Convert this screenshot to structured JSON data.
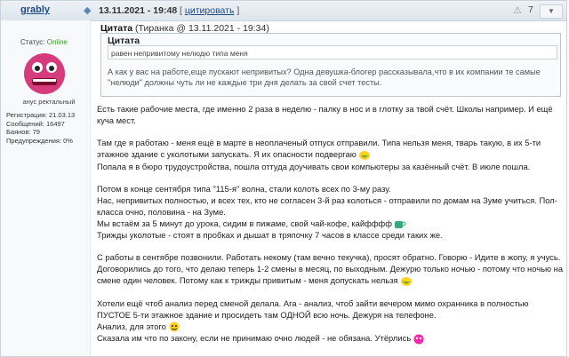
{
  "header": {
    "username": "grably",
    "date": "13.11.2021 - 19:48",
    "quote_button": "цитировать",
    "counter": "7",
    "menu_icon": "caret-down-icon"
  },
  "sidebar": {
    "status_label": "Статус:",
    "status_value": "Online",
    "avatar_caption": "анус ректальный",
    "stats": [
      "Регистрация: 21.03.13",
      "Сообщений: 16497",
      "Баянов: 79",
      "Предупреждения: 0%"
    ]
  },
  "quote": {
    "label": "Цитата",
    "author_info": "(Тиранка @ 13.11.2021 - 19:34)",
    "inner_label": "Цитата",
    "inner_text": "равен непривитому нелюдю типа меня",
    "text": "А как у вас на работе,еще пускают непривитых? Одна девушка-блогер рассказывала,что в их компании те самые \"нелюди\" должны чуть ли не каждые три дня делать за свой счет тесты."
  },
  "body": {
    "lines": [
      "Есть такие рабочие места, где именно 2 раза в неделю - палку в нос и в глотку за твой счёт. Школы например. И ещё куча мест.",
      "",
      "Там где я работаю - меня ещё в марте в неоплаченый отпуск отправили. Типа нельзя меня, тварь такую, в их 5-ти этажное здание с уколотыми запускать. Я их опасности подвергаю",
      "Попала я в бюро трудоустройства, пошла оттуда доучивать свои компьютеры за казённый счёт. В июле пошла.",
      "",
      "Потом в конце сентября типа \"115-я\" волна, стали колоть всех по 3-му разу.",
      "Нас, непривитых полностью, и всех тех, кто не согласен 3-й раз колоться - отправили по домам на Зуме учиться. Пол-класса очно, половина - на Зуме.",
      "Мы встаём за 5 минут до урока, сидим в пижаме, свой чай-кофе, кайфффф",
      "Трижды уколотые - стоят в пробках и дышат в тряпочку 7 часов в классе среди таких же.",
      "",
      "С работы в сентябре позвонили. Работать некому (там вечно текучка), просят обратно. Говорю - Идите в жопу, я учусь. Договорились до того, что делаю теперь 1-2 смены в месяц, по выходным. Дежурю только ночью - потому что ночью на смене один человек. Потому как к трижды привитым - меня допускать нельзя",
      "",
      "Хотели ещё чтоб анализ перед сменой делала. Ага - анализ, чтоб зайти вечером мимо охранника в полностью ПУСТОЕ 5-ти этажное здание и просидеть там ОДНОЙ всю ночь. Дежуря на телефоне.",
      "Анализ, для этого",
      "Сказала им что по закону, если не принимаю очно людей - не обязана. Утёрлись"
    ]
  }
}
